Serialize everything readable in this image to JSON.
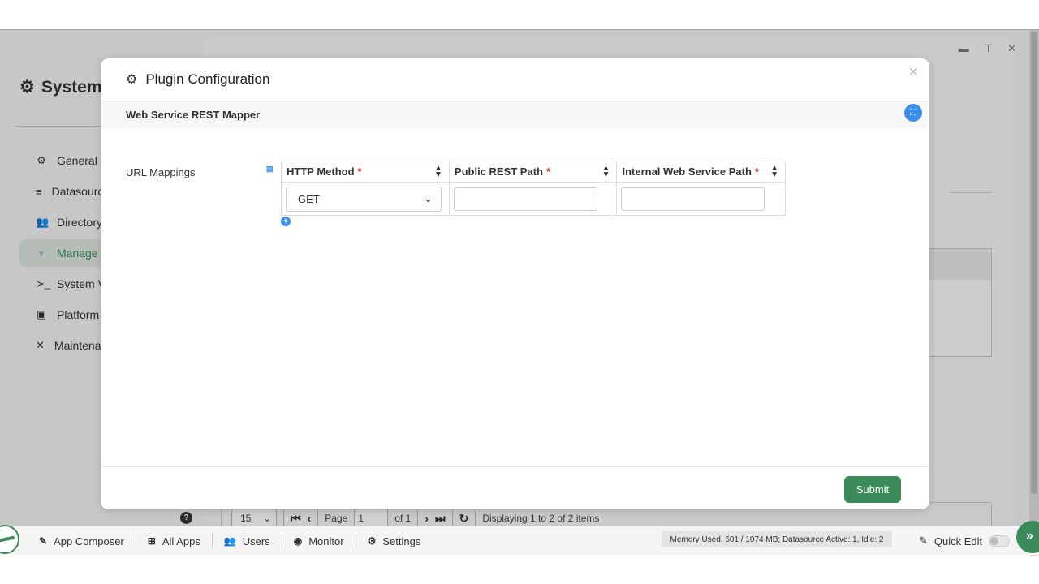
{
  "background": {
    "app_title": "System",
    "sidebar": [
      {
        "icon": "gear-icon",
        "glyph": "⚙",
        "label": "General"
      },
      {
        "icon": "database-icon",
        "glyph": "≡",
        "label": "Datasource"
      },
      {
        "icon": "users-icon",
        "glyph": "👥",
        "label": "Directory"
      },
      {
        "icon": "plug-icon",
        "glyph": "♆",
        "label": "Manage",
        "active": true
      },
      {
        "icon": "terminal-icon",
        "glyph": "≻_",
        "label": "System V"
      },
      {
        "icon": "platform-icon",
        "glyph": "▣",
        "label": "Platform"
      },
      {
        "icon": "tools-icon",
        "glyph": "✕",
        "label": "Maintenance"
      }
    ],
    "pager": {
      "page_size": "15",
      "page_label": "Page",
      "page_value": "1",
      "of_label": "of 1",
      "display_text": "Displaying 1 to 2 of 2 items"
    }
  },
  "taskbar": {
    "items": [
      {
        "icon": "edit-icon",
        "glyph": "✎",
        "label": "App Composer"
      },
      {
        "icon": "grid-icon",
        "glyph": "⊞",
        "label": "All Apps"
      },
      {
        "icon": "users-icon",
        "glyph": "👥",
        "label": "Users"
      },
      {
        "icon": "monitor-icon",
        "glyph": "◉",
        "label": "Monitor"
      },
      {
        "icon": "settings-icon",
        "glyph": "⚙",
        "label": "Settings"
      }
    ],
    "memory": "Memory Used: 601 / 1074 MB; Datasource Active: 1, Idle: 2",
    "quick_edit": "Quick Edit"
  },
  "modal": {
    "title": "Plugin Configuration",
    "subtitle": "Web Service REST Mapper",
    "field_label": "URL Mappings",
    "columns": [
      {
        "label": "HTTP Method",
        "required": "*"
      },
      {
        "label": "Public REST Path",
        "required": "*"
      },
      {
        "label": "Internal Web Service Path",
        "required": "*"
      }
    ],
    "rows": [
      {
        "method": "GET",
        "public_path": "",
        "internal_path": ""
      }
    ],
    "submit_label": "Submit"
  },
  "colors": {
    "accent_green": "#3a8a5a",
    "accent_blue": "#3b8df0",
    "required_red": "#d33333"
  }
}
